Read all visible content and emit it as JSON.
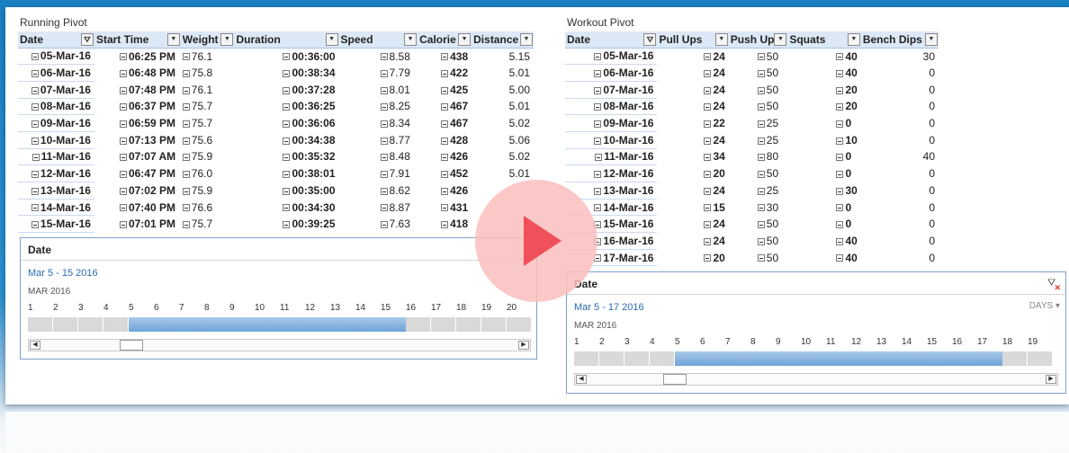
{
  "running": {
    "title": "Running Pivot",
    "headers": [
      "Date",
      "Start Time",
      "Weight",
      "Duration",
      "Speed",
      "Calorie",
      "Distance"
    ],
    "rows": [
      [
        "05-Mar-16",
        "06:25 PM",
        "76.1",
        "00:36:00",
        "8.58",
        "438",
        "5.15"
      ],
      [
        "06-Mar-16",
        "06:48 PM",
        "75.8",
        "00:38:34",
        "7.79",
        "422",
        "5.01"
      ],
      [
        "07-Mar-16",
        "07:48 PM",
        "76.1",
        "00:37:28",
        "8.01",
        "425",
        "5.00"
      ],
      [
        "08-Mar-16",
        "06:37 PM",
        "75.7",
        "00:36:25",
        "8.25",
        "467",
        "5.01"
      ],
      [
        "09-Mar-16",
        "06:59 PM",
        "75.7",
        "00:36:06",
        "8.34",
        "467",
        "5.02"
      ],
      [
        "10-Mar-16",
        "07:13 PM",
        "75.6",
        "00:34:38",
        "8.77",
        "428",
        "5.06"
      ],
      [
        "11-Mar-16",
        "07:07 AM",
        "75.9",
        "00:35:32",
        "8.48",
        "426",
        "5.02"
      ],
      [
        "12-Mar-16",
        "06:47 PM",
        "76.0",
        "00:38:01",
        "7.91",
        "452",
        "5.01"
      ],
      [
        "13-Mar-16",
        "07:02 PM",
        "75.9",
        "00:35:00",
        "8.62",
        "426",
        ""
      ],
      [
        "14-Mar-16",
        "07:40 PM",
        "76.6",
        "00:34:30",
        "8.87",
        "431",
        ""
      ],
      [
        "15-Mar-16",
        "07:01 PM",
        "75.7",
        "00:39:25",
        "7.63",
        "418",
        ""
      ]
    ],
    "slicer": {
      "header": "Date",
      "range": "Mar 5 - 15 2016",
      "month": "MAR 2016",
      "days": [
        "1",
        "2",
        "3",
        "4",
        "5",
        "6",
        "7",
        "8",
        "9",
        "10",
        "11",
        "12",
        "13",
        "14",
        "15",
        "16",
        "17",
        "18",
        "19",
        "20"
      ],
      "selected_from": 5,
      "selected_to": 15
    }
  },
  "workout": {
    "title": "Workout Pivot",
    "headers": [
      "Date",
      "Pull Ups",
      "Push Up",
      "Squats",
      "Bench Dips"
    ],
    "rows": [
      [
        "05-Mar-16",
        "24",
        "50",
        "40",
        "30"
      ],
      [
        "06-Mar-16",
        "24",
        "50",
        "40",
        "0"
      ],
      [
        "07-Mar-16",
        "24",
        "50",
        "20",
        "0"
      ],
      [
        "08-Mar-16",
        "24",
        "50",
        "20",
        "0"
      ],
      [
        "09-Mar-16",
        "22",
        "25",
        "0",
        "0"
      ],
      [
        "10-Mar-16",
        "24",
        "25",
        "10",
        "0"
      ],
      [
        "11-Mar-16",
        "34",
        "80",
        "0",
        "40"
      ],
      [
        "12-Mar-16",
        "20",
        "50",
        "0",
        "0"
      ],
      [
        "13-Mar-16",
        "24",
        "25",
        "30",
        "0"
      ],
      [
        "14-Mar-16",
        "15",
        "30",
        "0",
        "0"
      ],
      [
        "15-Mar-16",
        "24",
        "50",
        "0",
        "0"
      ],
      [
        "16-Mar-16",
        "24",
        "50",
        "40",
        "0"
      ],
      [
        "17-Mar-16",
        "20",
        "50",
        "40",
        "0"
      ]
    ],
    "slicer": {
      "header": "Date",
      "range": "Mar 5 - 17 2016",
      "days_label": "DAYS",
      "month": "MAR 2016",
      "days": [
        "1",
        "2",
        "3",
        "4",
        "5",
        "6",
        "7",
        "8",
        "9",
        "10",
        "11",
        "12",
        "13",
        "14",
        "15",
        "16",
        "17",
        "18",
        "19"
      ],
      "selected_from": 5,
      "selected_to": 17
    }
  },
  "icons": {
    "collapse": "minus-box-icon",
    "dropdown": "dropdown-arrow-icon",
    "filter": "filter-icon",
    "clear_filter": "clear-filter-icon",
    "play": "play-icon"
  },
  "colors": {
    "header_bg": "#dde8f6",
    "slicer_selected": "#6fa3d8",
    "slicer_text": "#2a6ab3",
    "play_circle": "#fabebe",
    "play_triangle": "#f0505a"
  }
}
